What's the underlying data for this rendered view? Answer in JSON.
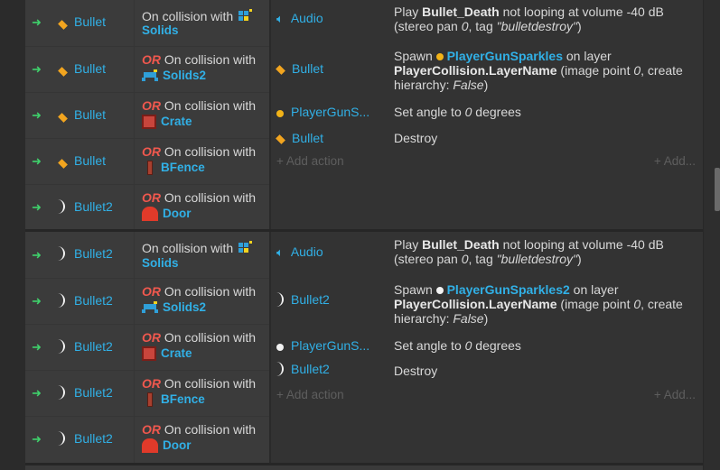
{
  "colors": {
    "object_name": "#31b0e6",
    "or_keyword": "#f0584e",
    "arrow": "#3fd16b",
    "bullet_icon": "#f2a51f"
  },
  "blocks": [
    {
      "conditions": [
        {
          "object": "Bullet",
          "icon": "bullet-diamond-icon",
          "or": "",
          "text": "On collision with",
          "target": "Solids",
          "target_icon": "tilemap-icon"
        },
        {
          "object": "Bullet",
          "icon": "bullet-diamond-icon",
          "or": "OR",
          "text": "On collision with",
          "target": "Solids2",
          "target_icon": "tilemap-alien-icon"
        },
        {
          "object": "Bullet",
          "icon": "bullet-diamond-icon",
          "or": "OR",
          "text": "On collision with",
          "target": "Crate",
          "target_icon": "crate-icon"
        },
        {
          "object": "Bullet",
          "icon": "bullet-diamond-icon",
          "or": "OR",
          "text": "On collision with",
          "target": "BFence",
          "target_icon": "fence-icon"
        },
        {
          "object": "Bullet2",
          "icon": "bullet2-bracket-icon",
          "or": "OR",
          "text": "On collision with",
          "target": "Door",
          "target_icon": "door-icon"
        }
      ],
      "actions": [
        {
          "object": "Audio",
          "icon": "speaker-icon",
          "pre": "Play ",
          "bold": "Bullet_Death",
          "post": " not looping at volume -40 dB (stereo pan ",
          "italic1": "0",
          "mid": ", tag ",
          "italic2": "\"bulletdestroy\"",
          "end": ")"
        },
        {
          "object": "Bullet",
          "icon": "bullet-diamond-icon",
          "pre": "Spawn ",
          "link": "PlayerGunSparkles",
          "link_icon": "yellow-dot-icon",
          "mid1": " on layer ",
          "bold": "PlayerCollision.LayerName",
          "mid2": " (image point ",
          "italic1": "0",
          "mid3": ", create hierarchy: ",
          "italic2": "False",
          "end": ")"
        },
        {
          "object": "PlayerGunS...",
          "icon": "yellow-dot-icon",
          "pre": "Set angle to ",
          "italic1": "0",
          "end": " degrees"
        },
        {
          "object": "Bullet",
          "icon": "bullet-diamond-icon",
          "pre": "Destroy"
        }
      ],
      "add_action": "Add action",
      "add_more": "Add..."
    },
    {
      "conditions": [
        {
          "object": "Bullet2",
          "icon": "bullet2-bracket-icon",
          "or": "",
          "text": "On collision with",
          "target": "Solids",
          "target_icon": "tilemap-icon"
        },
        {
          "object": "Bullet2",
          "icon": "bullet2-bracket-icon",
          "or": "OR",
          "text": "On collision with",
          "target": "Solids2",
          "target_icon": "tilemap-alien-icon"
        },
        {
          "object": "Bullet2",
          "icon": "bullet2-bracket-icon",
          "or": "OR",
          "text": "On collision with",
          "target": "Crate",
          "target_icon": "crate-icon"
        },
        {
          "object": "Bullet2",
          "icon": "bullet2-bracket-icon",
          "or": "OR",
          "text": "On collision with",
          "target": "BFence",
          "target_icon": "fence-icon"
        },
        {
          "object": "Bullet2",
          "icon": "bullet2-bracket-icon",
          "or": "OR",
          "text": "On collision with",
          "target": "Door",
          "target_icon": "door-icon"
        }
      ],
      "actions": [
        {
          "object": "Audio",
          "icon": "speaker-icon",
          "pre": "Play ",
          "bold": "Bullet_Death",
          "post": " not looping at volume -40 dB (stereo pan ",
          "italic1": "0",
          "mid": ", tag ",
          "italic2": "\"bulletdestroy\"",
          "end": ")"
        },
        {
          "object": "Bullet2",
          "icon": "bullet2-bracket-icon",
          "pre": "Spawn ",
          "link": "PlayerGunSparkles2",
          "link_icon": "white-dot-icon",
          "mid1": " on layer ",
          "bold": "PlayerCollision.LayerName",
          "mid2": " (image point ",
          "italic1": "0",
          "mid3": ", create hierarchy: ",
          "italic2": "False",
          "end": ")"
        },
        {
          "object": "PlayerGunS...",
          "icon": "white-dot-icon",
          "pre": "Set angle to ",
          "italic1": "0",
          "end": " degrees"
        },
        {
          "object": "Bullet2",
          "icon": "bullet2-bracket-icon",
          "pre": "Destroy"
        }
      ],
      "add_action": "Add action",
      "add_more": "Add..."
    }
  ]
}
